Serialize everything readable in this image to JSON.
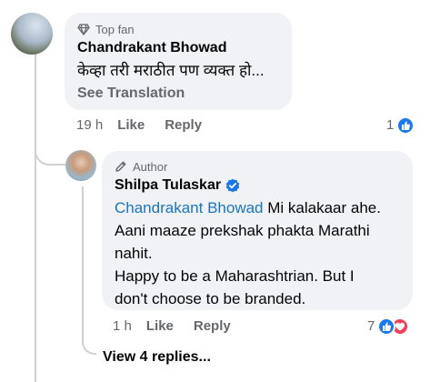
{
  "comment": {
    "badge": "Top fan",
    "author": "Chandrakant Bhowad",
    "text": "केव्हा तरी मराठीत पण व्यक्त हो...",
    "see_translation": "See Translation",
    "time": "19 h",
    "like_label": "Like",
    "reply_label": "Reply",
    "reaction_count": "1",
    "reaction_icons": [
      "like-icon"
    ]
  },
  "reply": {
    "badge": "Author",
    "author": "Shilpa Tulaskar",
    "verified_icon": "verified-badge-icon",
    "mention": "Chandrakant Bhowad",
    "line1_rest": " Mi kalakaar ahe.",
    "line2": "Aani maaze prekshak phakta Marathi",
    "line3": "nahit.",
    "line4": "Happy to be a Maharashtrian. But I",
    "line5": "don't choose to be branded.",
    "time": "1 h",
    "like_label": "Like",
    "reply_label": "Reply",
    "reaction_count": "7",
    "reaction_icons": [
      "like-icon",
      "love-icon"
    ]
  },
  "view_replies": "View 4 replies...",
  "colors": {
    "bubble": "#f0f2f5",
    "link": "#1a74c4",
    "secondary_text": "#65676b",
    "like": "#1877f2",
    "love": "#f33e58",
    "verified": "#1877f2"
  }
}
